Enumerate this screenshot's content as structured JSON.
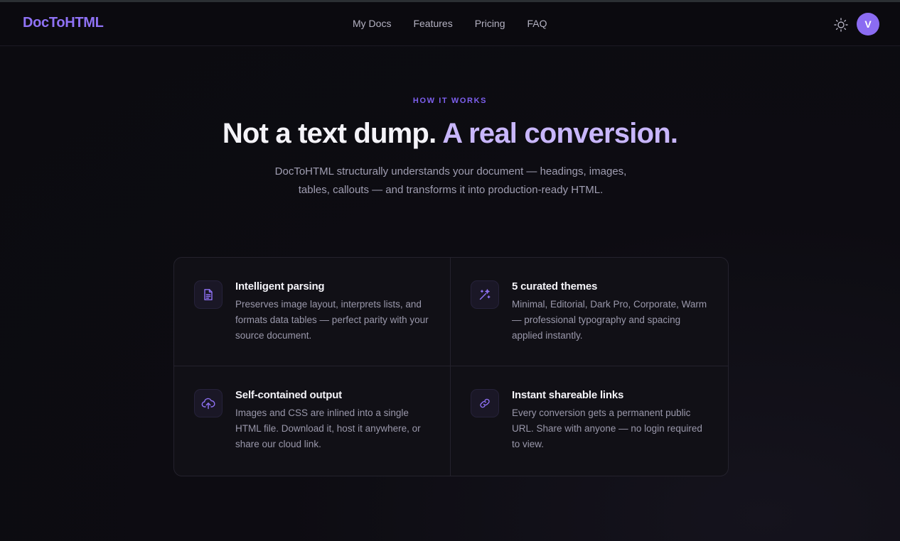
{
  "nav": {
    "logo": "DocToHTML",
    "links": [
      "My Docs",
      "Features",
      "Pricing",
      "FAQ"
    ],
    "avatar_initial": "V",
    "theme_icon": "sun-icon"
  },
  "hero": {
    "eyebrow": "HOW IT WORKS",
    "headline_main": "Not a text dump.",
    "headline_accent": "A real conversion.",
    "subtitle": "DocToHTML structurally understands your document — headings, images, tables, callouts — and transforms it into production-ready HTML."
  },
  "features": [
    {
      "icon": "document-icon",
      "title": "Intelligent parsing",
      "desc": "Preserves image layout, interprets lists, and formats data tables — perfect parity with your source document."
    },
    {
      "icon": "magic-wand-icon",
      "title": "5 curated themes",
      "desc": "Minimal, Editorial, Dark Pro, Corporate, Warm — professional typography and spacing applied instantly."
    },
    {
      "icon": "cloud-upload-icon",
      "title": "Self-contained output",
      "desc": "Images and CSS are inlined into a single HTML file. Download it, host it anywhere, or share our cloud link."
    },
    {
      "icon": "link-icon",
      "title": "Instant shareable links",
      "desc": "Every conversion gets a permanent public URL. Share with anyone — no login required to view."
    }
  ],
  "colors": {
    "accent": "#8f72f5",
    "accent_light": "#c8b6fb",
    "background": "#0c0b10",
    "card": "#111016"
  }
}
